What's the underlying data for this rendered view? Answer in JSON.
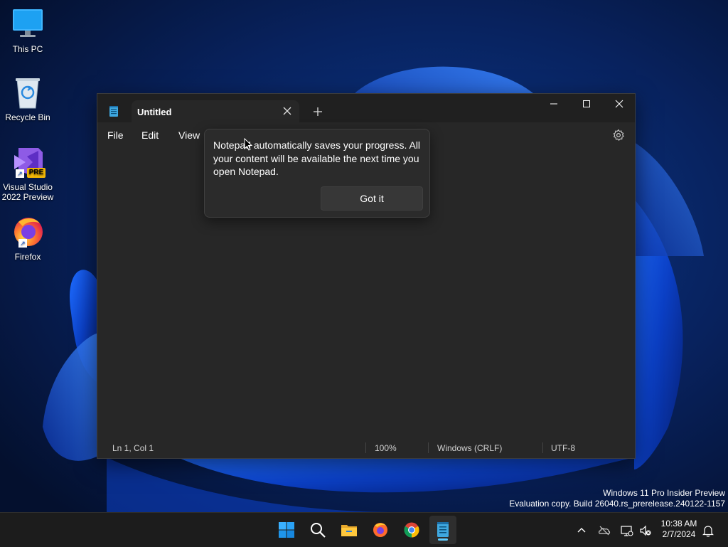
{
  "desktop": {
    "icons": [
      {
        "label": "This PC",
        "icon": "monitor-icon"
      },
      {
        "label": "Recycle Bin",
        "icon": "recycle-bin-icon"
      },
      {
        "label": "Visual Studio 2022 Preview",
        "icon": "visual-studio-icon",
        "badge": "PRE"
      },
      {
        "label": "Firefox",
        "icon": "firefox-icon"
      }
    ]
  },
  "notepad": {
    "tab_title": "Untitled",
    "menu": [
      "File",
      "Edit",
      "View"
    ],
    "status": {
      "position": "Ln 1, Col 1",
      "zoom": "100%",
      "line_ending": "Windows (CRLF)",
      "encoding": "UTF-8"
    }
  },
  "teaching_tip": {
    "message": "Notepad automatically saves your progress. All your content will be available the next time you open Notepad.",
    "button": "Got it"
  },
  "watermark": {
    "line1": "Windows 11 Pro Insider Preview",
    "line2": "Evaluation copy. Build 26040.rs_prerelease.240122-1157"
  },
  "taskbar": {
    "apps": [
      "start-icon",
      "search-icon",
      "file-explorer-icon",
      "firefox-icon",
      "chrome-icon",
      "notepad-icon"
    ],
    "clock": {
      "time": "10:38 AM",
      "date": "2/7/2024"
    }
  },
  "colors": {
    "accent": "#60cdff",
    "window_bg": "#272727",
    "titlebar_bg": "#202020",
    "taskbar_bg": "#1c1c1c"
  }
}
